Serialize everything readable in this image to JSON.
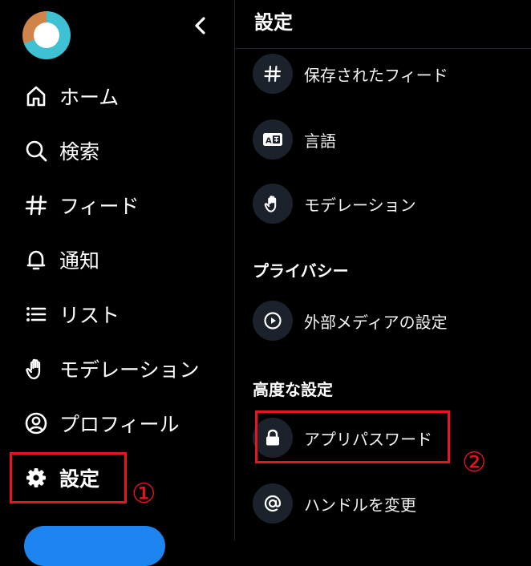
{
  "sidebar": {
    "items": [
      {
        "label": "ホーム",
        "icon": "home-icon"
      },
      {
        "label": "検索",
        "icon": "search-icon"
      },
      {
        "label": "フィード",
        "icon": "hash-icon"
      },
      {
        "label": "通知",
        "icon": "bell-icon"
      },
      {
        "label": "リスト",
        "icon": "list-icon"
      },
      {
        "label": "モデレーション",
        "icon": "hand-icon"
      },
      {
        "label": "プロフィール",
        "icon": "user-circle-icon"
      },
      {
        "label": "設定",
        "icon": "gear-icon",
        "active": true
      }
    ]
  },
  "settings": {
    "title": "設定",
    "rows_top": [
      {
        "label": "保存されたフィード",
        "icon": "hash-icon"
      },
      {
        "label": "言語",
        "icon": "language-icon"
      },
      {
        "label": "モデレーション",
        "icon": "hand-icon"
      }
    ],
    "privacy_header": "プライバシー",
    "privacy_rows": [
      {
        "label": "外部メディアの設定",
        "icon": "play-circle-icon"
      }
    ],
    "advanced_header": "高度な設定",
    "advanced_rows": [
      {
        "label": "アプリパスワード",
        "icon": "lock-icon"
      },
      {
        "label": "ハンドルを変更",
        "icon": "at-icon"
      }
    ]
  },
  "annotations": {
    "marker_1": "①",
    "marker_2": "②"
  },
  "colors": {
    "background": "#000000",
    "panel_circle": "#1b222c",
    "highlight": "#e8141f",
    "accent_button": "#1d85f0"
  }
}
